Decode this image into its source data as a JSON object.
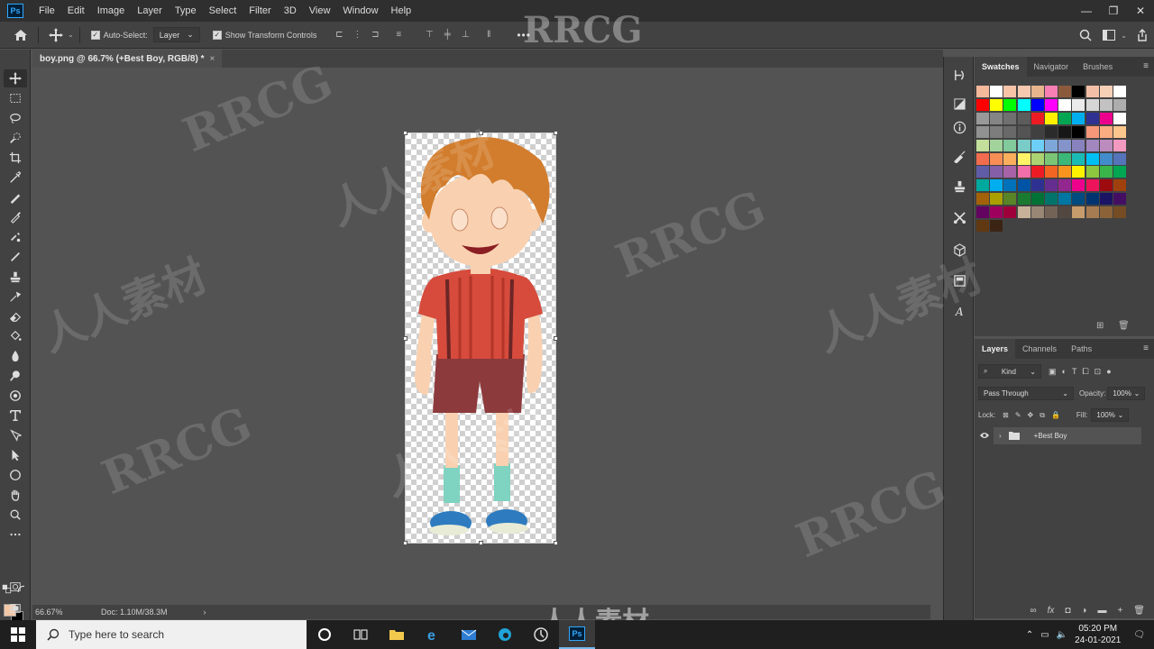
{
  "app": {
    "logo": "Ps"
  },
  "menu": [
    "File",
    "Edit",
    "Image",
    "Layer",
    "Type",
    "Select",
    "Filter",
    "3D",
    "View",
    "Window",
    "Help"
  ],
  "options": {
    "auto_select_label": "Auto-Select:",
    "auto_select_target": "Layer",
    "show_transform_label": "Show Transform Controls",
    "more": "•••"
  },
  "document": {
    "tab_title": "boy.png @ 66.7% (+Best Boy, RGB/8) *",
    "close": "×",
    "zoom": "66.67%",
    "doc_info": "Doc: 1.10M/38.3M",
    "status_arrow": "›"
  },
  "colors": {
    "foreground": "#f3c7a6",
    "background": "#000000"
  },
  "swatches_panel": {
    "tabs": [
      "Swatches",
      "Navigator",
      "Brushes"
    ],
    "rows": [
      [
        "#f4b89b",
        "#ffffff",
        "#f7c4a8",
        "#f5c9b0",
        "#e8b48e",
        "#f77fb4",
        "#8b5a3c",
        "#000000",
        "#f3c0a7",
        "#f6cfb7",
        "#ffffff"
      ],
      [
        "#ff0000",
        "#ffff00",
        "#00ff00",
        "#00ffff",
        "#0000ff",
        "#ff00ff",
        "#ffffff",
        "#ebebeb",
        "#d6d6d6",
        "#c2c2c2",
        "#adadad"
      ],
      [
        "#999999",
        "#858585",
        "#707070",
        "#5c5c5c",
        "#ed1c24",
        "#fff200",
        "#00a651",
        "#00aeef",
        "#2e3192",
        "#ec008c",
        "#ffffff"
      ],
      [
        "#919191",
        "#7d7d7d",
        "#696969",
        "#545454",
        "#404040",
        "#2b2b2b",
        "#171717",
        "#000000",
        "#f7977a",
        "#fbad82",
        "#fdc68c"
      ],
      [
        "#c4df9b",
        "#a3d39c",
        "#82ca9c",
        "#7accc8",
        "#6dcff6",
        "#7da7d9",
        "#8493ca",
        "#8882be",
        "#a187be",
        "#bc8cbf",
        "#f49ac1"
      ],
      [
        "#f26c4f",
        "#f68e55",
        "#fbaf5c",
        "#fff467",
        "#acd372",
        "#7cc576",
        "#3bb878",
        "#1abbb4",
        "#00bff3",
        "#438ccb",
        "#5574b9"
      ],
      [
        "#605ca8",
        "#855fa8",
        "#a763a8",
        "#f06ea9",
        "#ed1c24",
        "#f26522",
        "#f7941d",
        "#fff200",
        "#8dc63f",
        "#39b54a",
        "#00a651"
      ],
      [
        "#00a99d",
        "#00aeef",
        "#0072bc",
        "#0054a6",
        "#2e3192",
        "#662d91",
        "#92278f",
        "#ec008c",
        "#ed145b",
        "#9e0b0f",
        "#a0410d"
      ],
      [
        "#a3620a",
        "#aba000",
        "#598527",
        "#1a7b30",
        "#007236",
        "#00746b",
        "#0076a3",
        "#004b80",
        "#003471",
        "#1b1464",
        "#440e62"
      ],
      [
        "#630460",
        "#9e005d",
        "#9e0039",
        "#c7b299",
        "#998675",
        "#736357",
        "#534741",
        "#c69c6d",
        "#a67c52",
        "#8c6239",
        "#754c24"
      ],
      [
        "#603913",
        "#3c2415"
      ]
    ]
  },
  "layers_panel": {
    "tabs": [
      "Layers",
      "Channels",
      "Paths"
    ],
    "filter": "Kind",
    "blend_mode": "Pass Through",
    "opacity_label": "Opacity:",
    "opacity_value": "100%",
    "lock_label": "Lock:",
    "fill_label": "Fill:",
    "fill_value": "100%",
    "layers": [
      {
        "name": "+Best Boy",
        "type": "group",
        "visible": true
      }
    ],
    "footer": [
      "∞",
      "fx",
      "◘",
      "◑",
      "▬",
      "+",
      "🗑"
    ]
  },
  "taskbar": {
    "search_placeholder": "Type here to search",
    "time": "05:20 PM",
    "date": "24-01-2021"
  },
  "watermark": {
    "latin": "RRCG",
    "cjk": "人人素材"
  }
}
